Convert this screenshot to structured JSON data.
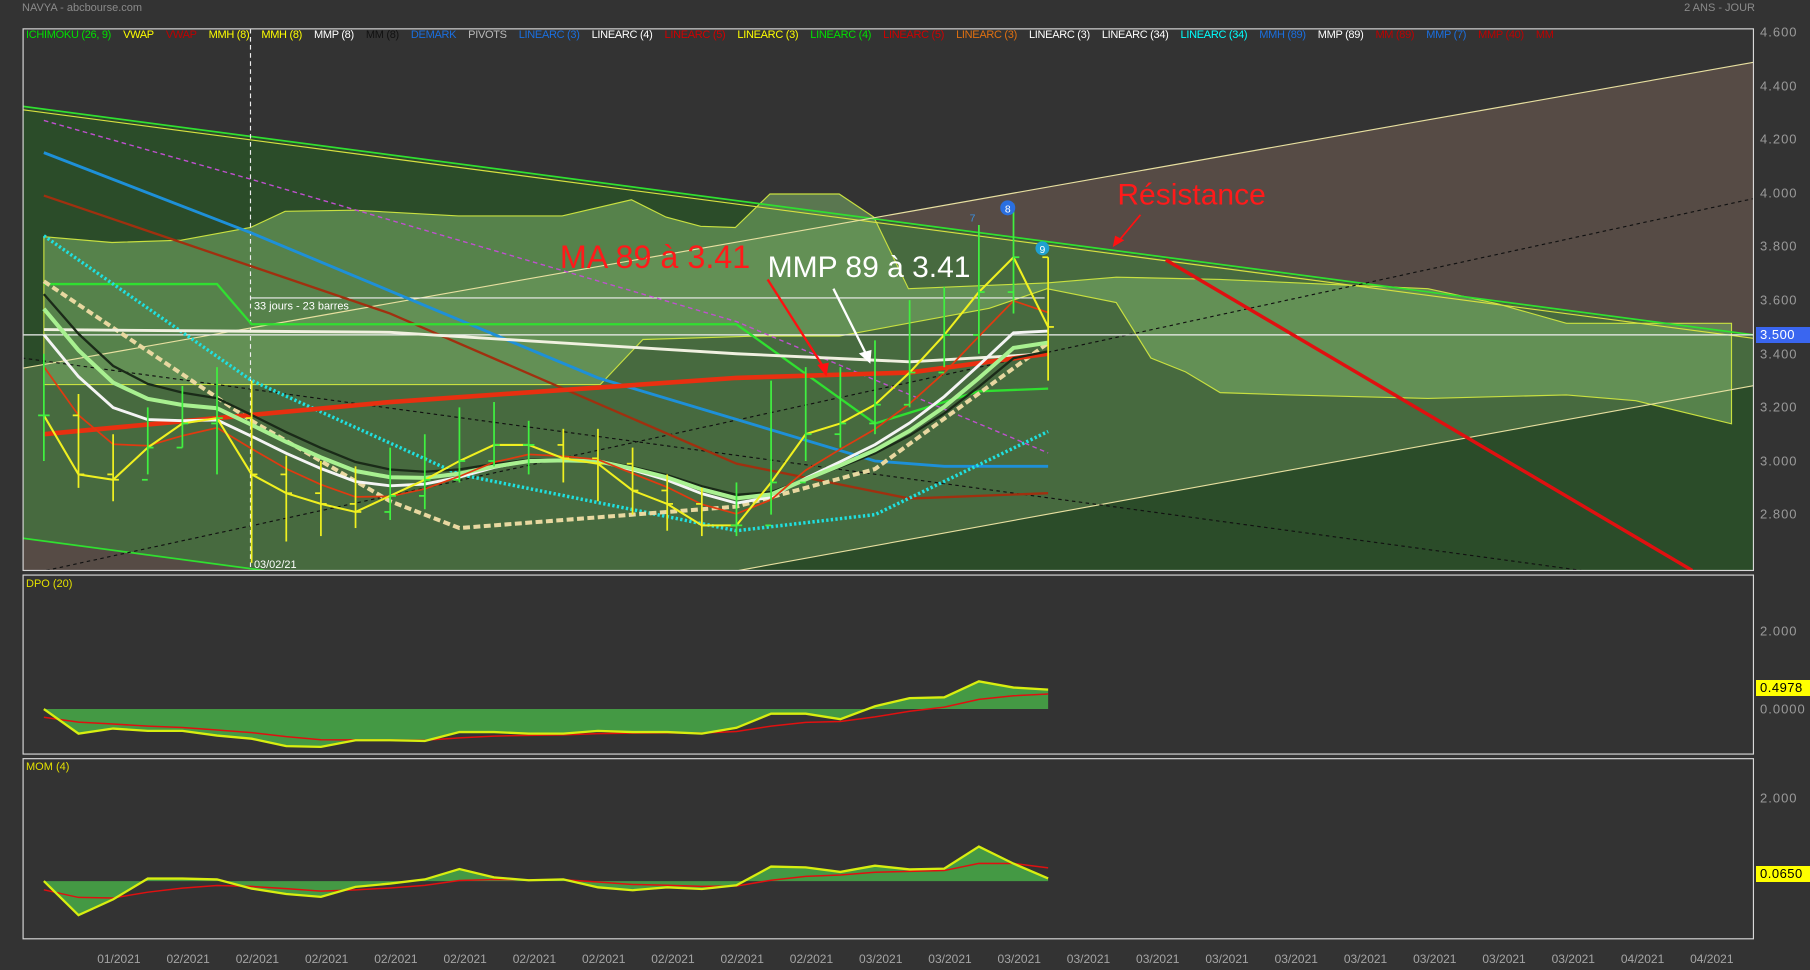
{
  "header": {
    "title": "NAVYA - abcbourse.com",
    "period": "2 ANS - JOUR"
  },
  "legend": [
    {
      "label": "ICHIMOKU (26, 9)",
      "color": "#00e000"
    },
    {
      "label": "VWAP",
      "color": "#ffff00"
    },
    {
      "label": "VWAP",
      "color": "#c00000"
    },
    {
      "label": "MMH (8)",
      "color": "#ffff00"
    },
    {
      "label": "MMH (8)",
      "color": "#ffff00"
    },
    {
      "label": "MMP (8)",
      "color": "#ffffff"
    },
    {
      "label": "MM (8)",
      "color": "#111111"
    },
    {
      "label": "DEMARK",
      "color": "#1a6fe0"
    },
    {
      "label": "PIVOTS",
      "color": "#bbbbbb"
    },
    {
      "label": "LINEARC (3)",
      "color": "#1a6fe0"
    },
    {
      "label": "LINEARC (4)",
      "color": "#ffffff"
    },
    {
      "label": "LINEARC (5)",
      "color": "#d00000"
    },
    {
      "label": "LINEARC (3)",
      "color": "#ffff00"
    },
    {
      "label": "LINEARC (4)",
      "color": "#00e000"
    },
    {
      "label": "LINEARC (5)",
      "color": "#d00000"
    },
    {
      "label": "LINEARC (3)",
      "color": "#e07010"
    },
    {
      "label": "LINEARC (3)",
      "color": "#ffffff"
    },
    {
      "label": "LINEARC (34)",
      "color": "#ffffff"
    },
    {
      "label": "LINEARC (34)",
      "color": "#00ffff"
    },
    {
      "label": "MMH (89)",
      "color": "#1a6fe0"
    },
    {
      "label": "MMP (89)",
      "color": "#ffffff"
    },
    {
      "label": "MM (89)",
      "color": "#c00000"
    },
    {
      "label": "MMP (7)",
      "color": "#1a6fe0"
    },
    {
      "label": "MMP (40)",
      "color": "#c00000"
    },
    {
      "label": "MM",
      "color": "#c00000"
    }
  ],
  "price_axis": [
    "4.600",
    "4.400",
    "4.200",
    "4.000",
    "3.800",
    "3.600",
    "3.400",
    "3.200",
    "3.000",
    "2.800"
  ],
  "current_price": "3.500",
  "annotations": {
    "ma89": "MA 89 à 3.41",
    "mmp89": "MMP 89 à 3.41",
    "resistance": "Résistance",
    "measure": "33 jours - 23 barres",
    "date_marker": "03/02/21",
    "marker_7": "7",
    "marker_8": "8",
    "marker_9": "9"
  },
  "panels": {
    "dpo": {
      "title": "DPO (20)",
      "axis": [
        "2.000",
        "0.0000"
      ],
      "last": "0.4978"
    },
    "mom": {
      "title": "MOM (4)",
      "axis": [
        "2.000"
      ],
      "last": "0.0650"
    }
  },
  "dates": [
    "01/2021",
    "02/2021",
    "02/2021",
    "02/2021",
    "02/2021",
    "02/2021",
    "02/2021",
    "02/2021",
    "02/2021",
    "02/2021",
    "02/2021",
    "03/2021",
    "03/2021",
    "03/2021",
    "03/2021",
    "03/2021",
    "03/2021",
    "03/2021",
    "03/2021",
    "03/2021",
    "03/2021",
    "03/2021",
    "04/2021",
    "04/2021"
  ],
  "chart_data": {
    "type": "line",
    "ylim": [
      2.62,
      4.6
    ],
    "close": [
      3.17,
      2.95,
      2.93,
      3.05,
      3.14,
      3.16,
      2.95,
      2.88,
      2.84,
      2.81,
      2.87,
      2.93,
      3.0,
      3.06,
      3.06,
      3.01,
      2.99,
      2.89,
      2.84,
      2.76,
      2.76,
      2.92,
      3.1,
      3.14,
      3.21,
      3.33,
      3.47,
      3.63,
      3.76,
      3.5
    ],
    "high": [
      3.4,
      3.25,
      3.1,
      3.2,
      3.28,
      3.35,
      3.3,
      3.02,
      3.0,
      2.98,
      3.05,
      3.1,
      3.2,
      3.22,
      3.15,
      3.12,
      3.12,
      3.05,
      2.95,
      2.9,
      2.92,
      3.3,
      3.35,
      3.35,
      3.45,
      3.6,
      3.65,
      3.88,
      3.96,
      3.76
    ],
    "low": [
      3.0,
      2.9,
      2.85,
      2.95,
      3.05,
      2.95,
      2.62,
      2.7,
      2.72,
      2.75,
      2.78,
      2.82,
      2.92,
      2.98,
      2.95,
      2.92,
      2.85,
      2.8,
      2.74,
      2.72,
      2.72,
      2.8,
      3.0,
      3.05,
      3.1,
      3.2,
      3.35,
      3.4,
      3.55,
      3.3
    ],
    "lines": [
      {
        "name": "mmh-89",
        "color": "#1e90d8",
        "width": 2.5,
        "dash": "",
        "points": [
          [
            0,
            4.15
          ],
          [
            6,
            3.85
          ],
          [
            16,
            3.31
          ],
          [
            24,
            3.0
          ],
          [
            26,
            2.98
          ],
          [
            29,
            2.98
          ]
        ]
      },
      {
        "name": "mm-long",
        "color": "#a0300f",
        "width": 2,
        "dash": "",
        "points": [
          [
            0,
            3.99
          ],
          [
            10,
            3.55
          ],
          [
            20,
            2.99
          ],
          [
            25,
            2.86
          ],
          [
            29,
            2.88
          ]
        ]
      },
      {
        "name": "magenta-avg",
        "color": "#c050d0",
        "width": 1.2,
        "dash": "4,3",
        "points": [
          [
            0,
            4.27
          ],
          [
            6,
            4.05
          ],
          [
            20,
            3.52
          ],
          [
            29,
            3.03
          ]
        ]
      },
      {
        "name": "kijun",
        "color": "#30e030",
        "width": 2,
        "dash": "",
        "points": [
          [
            0,
            3.66
          ],
          [
            5,
            3.66
          ],
          [
            6,
            3.51
          ],
          [
            20,
            3.51
          ],
          [
            24,
            3.14
          ],
          [
            27,
            3.26
          ],
          [
            29,
            3.27
          ]
        ]
      },
      {
        "name": "cyan-linearc-34",
        "color": "#20e0e0",
        "width": 3,
        "dash": "2,2",
        "points": [
          [
            0,
            3.84
          ],
          [
            6,
            3.3
          ],
          [
            12,
            2.95
          ],
          [
            20,
            2.74
          ],
          [
            24,
            2.8
          ],
          [
            29,
            3.11
          ]
        ]
      },
      {
        "name": "beige-avg",
        "color": "#e8d8a0",
        "width": 3.5,
        "dash": "6,3",
        "points": [
          [
            0,
            3.67
          ],
          [
            6,
            3.15
          ],
          [
            10,
            2.85
          ],
          [
            12,
            2.75
          ],
          [
            20,
            2.83
          ],
          [
            24,
            2.97
          ],
          [
            29,
            3.44
          ]
        ]
      },
      {
        "name": "mmp-89",
        "color": "#f0f0e0",
        "width": 2.5,
        "dash": "",
        "points": [
          [
            0,
            3.49
          ],
          [
            10,
            3.48
          ],
          [
            20,
            3.4
          ],
          [
            25,
            3.37
          ],
          [
            29,
            3.4
          ]
        ]
      },
      {
        "name": "ma-89",
        "color": "#e83010",
        "width": 4,
        "dash": "",
        "points": [
          [
            0,
            3.1
          ],
          [
            10,
            3.22
          ],
          [
            20,
            3.31
          ],
          [
            25,
            3.33
          ],
          [
            29,
            3.4
          ]
        ]
      }
    ],
    "dpo": [
      0,
      -0.63,
      -0.5,
      -0.56,
      -0.56,
      -0.68,
      -0.76,
      -0.95,
      -0.97,
      -0.8,
      -0.8,
      -0.82,
      -0.59,
      -0.59,
      -0.63,
      -0.63,
      -0.56,
      -0.59,
      -0.59,
      -0.63,
      -0.48,
      -0.12,
      -0.12,
      -0.26,
      0.07,
      0.28,
      0.3,
      0.71,
      0.55,
      0.4978
    ],
    "mom": [
      0,
      -0.82,
      -0.44,
      0.06,
      0.06,
      0.04,
      -0.18,
      -0.31,
      -0.38,
      -0.14,
      -0.06,
      0.04,
      0.29,
      0.09,
      0.02,
      0.04,
      -0.15,
      -0.22,
      -0.15,
      -0.19,
      -0.1,
      0.35,
      0.33,
      0.22,
      0.37,
      0.28,
      0.3,
      0.83,
      0.42,
      0.065
    ]
  }
}
